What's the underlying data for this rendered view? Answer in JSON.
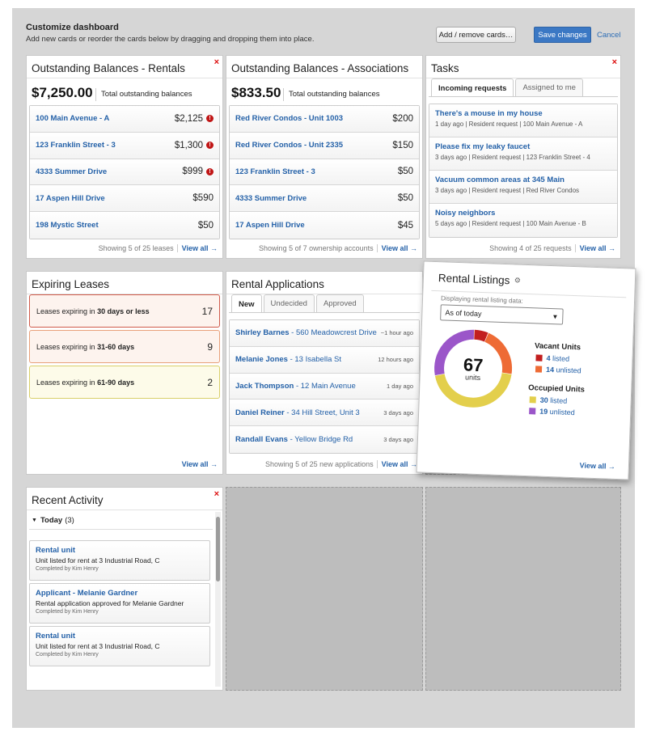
{
  "header": {
    "title": "Customize dashboard",
    "subtitle": "Add new cards or reorder the cards below by dragging and dropping them into place.",
    "add_remove_label": "Add / remove cards…",
    "save_label": "Save changes",
    "cancel_label": "Cancel"
  },
  "common": {
    "close_glyph": "×",
    "view_all": "View all →"
  },
  "balances_rentals": {
    "title": "Outstanding Balances - Rentals",
    "total": "$7,250.00",
    "total_label": "Total outstanding balances",
    "rows": [
      {
        "name": "100 Main Avenue - A",
        "amount": "$2,125",
        "alert": true
      },
      {
        "name": "123 Franklin Street - 3",
        "amount": "$1,300",
        "alert": true
      },
      {
        "name": "4333 Summer Drive",
        "amount": "$999",
        "alert": true
      },
      {
        "name": "17 Aspen Hill Drive",
        "amount": "$590",
        "alert": false
      },
      {
        "name": "198 Mystic Street",
        "amount": "$50",
        "alert": false
      }
    ],
    "footer": "Showing 5 of 25 leases"
  },
  "balances_associations": {
    "title": "Outstanding Balances - Associations",
    "total": "$833.50",
    "total_label": "Total outstanding balances",
    "rows": [
      {
        "name": "Red River Condos - Unit 1003",
        "amount": "$200"
      },
      {
        "name": "Red River Condos - Unit 2335",
        "amount": "$150"
      },
      {
        "name": "123 Franklin Street - 3",
        "amount": "$50"
      },
      {
        "name": "4333 Summer Drive",
        "amount": "$50"
      },
      {
        "name": "17 Aspen Hill Drive",
        "amount": "$45"
      }
    ],
    "footer": "Showing 5 of 7 ownership accounts"
  },
  "tasks": {
    "title": "Tasks",
    "tabs": [
      "Incoming requests",
      "Assigned to me"
    ],
    "rows": [
      {
        "title": "There's a mouse in my house",
        "meta": "1 day ago | Resident request | 100 Main Avenue - A"
      },
      {
        "title": "Please fix my leaky faucet",
        "meta": "3 days ago | Resident request | 123 Franklin Street - 4"
      },
      {
        "title": "Vacuum common areas at 345 Main",
        "meta": "3 days ago | Resident request | Red River Condos"
      },
      {
        "title": "Noisy neighbors",
        "meta": "5 days ago | Resident request | 100 Main Avenue - B"
      }
    ],
    "footer": "Showing 4 of 25 requests"
  },
  "expiring": {
    "title": "Expiring Leases",
    "prefix": "Leases expiring in",
    "rows": [
      {
        "range": "30 days or less",
        "count": "17",
        "bg": "#fdf3ee",
        "border": "#d05a4a"
      },
      {
        "range": "31-60 days",
        "count": "9",
        "bg": "#fdf3ee",
        "border": "#e8a07a"
      },
      {
        "range": "61-90 days",
        "count": "2",
        "bg": "#fdfbe9",
        "border": "#d9cf6a"
      }
    ]
  },
  "applications": {
    "title": "Rental Applications",
    "tabs": [
      "New",
      "Undecided",
      "Approved"
    ],
    "rows": [
      {
        "name": "Shirley Barnes",
        "addr": " - 560 Meadowcrest Drive",
        "time": "~1 hour ago"
      },
      {
        "name": "Melanie Jones",
        "addr": " - 13 Isabella St",
        "time": "12 hours ago"
      },
      {
        "name": "Jack Thompson",
        "addr": " - 12 Main Avenue",
        "time": "1 day ago"
      },
      {
        "name": "Daniel Reiner",
        "addr": " - 34 Hill Street, Unit 3",
        "time": "3 days ago"
      },
      {
        "name": "Randall Evans",
        "addr": " - Yellow Bridge Rd",
        "time": "3 days ago"
      }
    ],
    "footer": "Showing 5 of 25 new applications"
  },
  "listings": {
    "title": "Rental Listings",
    "gear_icon": "gear-icon",
    "sub": "Displaying rental listing data:",
    "select_value": "As of today",
    "total": "67",
    "unit": "units",
    "vacant_heading": "Vacant Units",
    "occupied_heading": "Occupied Units",
    "segments": [
      {
        "count": "4",
        "label": "listed",
        "color": "#c21f1f",
        "group": "vacant",
        "value": 4
      },
      {
        "count": "14",
        "label": "unlisted",
        "color": "#ee6b35",
        "group": "vacant",
        "value": 14
      },
      {
        "count": "30",
        "label": "listed",
        "color": "#e3cf4c",
        "group": "occupied",
        "value": 30
      },
      {
        "count": "19",
        "label": "unlisted",
        "color": "#9b56c9",
        "group": "occupied",
        "value": 19
      }
    ]
  },
  "recent": {
    "title": "Recent Activity",
    "group": "Today",
    "group_count": "(3)",
    "items": [
      {
        "title": "Rental unit",
        "desc": "Unit listed for rent at 3 Industrial Road, C",
        "by": "Completed by Kim Henry"
      },
      {
        "title": "Applicant - Melanie Gardner",
        "desc": "Rental application approved for Melanie Gardner",
        "by": "Completed by Kim Henry"
      },
      {
        "title": "Rental unit",
        "desc": "Unit listed for rent at 3 Industrial Road, C",
        "by": "Completed by Kim Henry"
      }
    ]
  }
}
